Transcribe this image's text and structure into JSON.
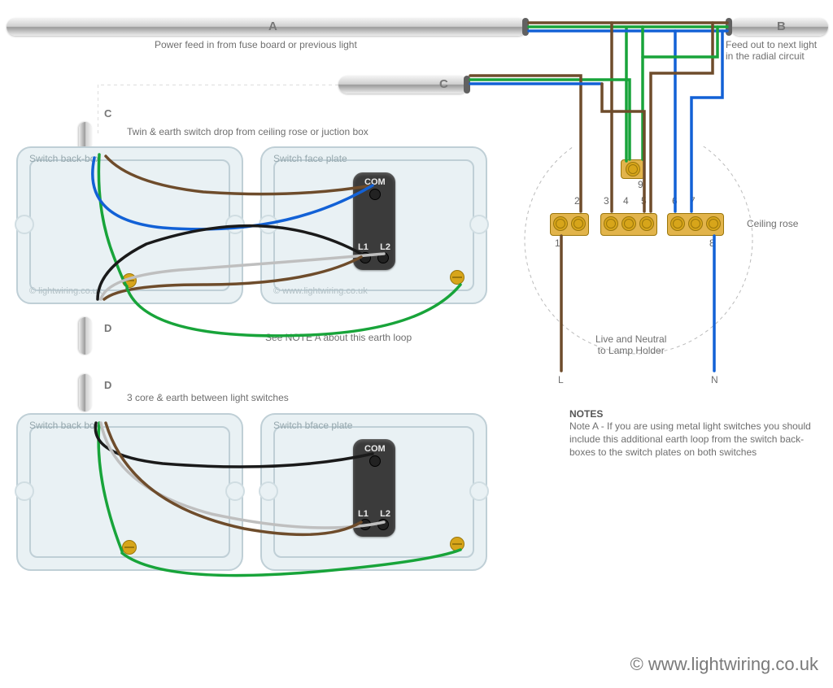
{
  "cables": {
    "A": {
      "label": "A",
      "desc": "Power feed in from fuse board or previous light"
    },
    "B": {
      "label": "B",
      "desc": "Feed out to next light\nin the radial circuit"
    },
    "C": {
      "label": "C",
      "desc": "Twin & earth switch drop from ceiling rose or juction box"
    },
    "D": {
      "label": "D",
      "desc": "3 core & earth between light switches"
    }
  },
  "boxes": {
    "back1": {
      "label": "Switch back-box",
      "copy": "© lightwiring.co.uk"
    },
    "face1": {
      "label": "Switch face plate",
      "copy": "© www.lightwiring.co.uk"
    },
    "back2": {
      "label": "Switch back box",
      "copy": ""
    },
    "face2": {
      "label": "Switch bface plate",
      "copy": ""
    }
  },
  "switch": {
    "com": "COM",
    "l1": "L1",
    "l2": "L2"
  },
  "note_a_inline": "See NOTE A about this earth loop",
  "ceiling": {
    "label": "Ceiling rose",
    "holder": "Live and Neutral\nto Lamp Holder",
    "L": "L",
    "N": "N",
    "nums": [
      "1",
      "2",
      "3",
      "4",
      "5",
      "6",
      "7",
      "8",
      "9"
    ]
  },
  "notes": {
    "heading": "NOTES",
    "body": "Note A - If you are using metal light switches you should include this additional earth loop from the switch back-boxes to the switch plates on both switches"
  },
  "copyright": "© www.lightwiring.co.uk"
}
